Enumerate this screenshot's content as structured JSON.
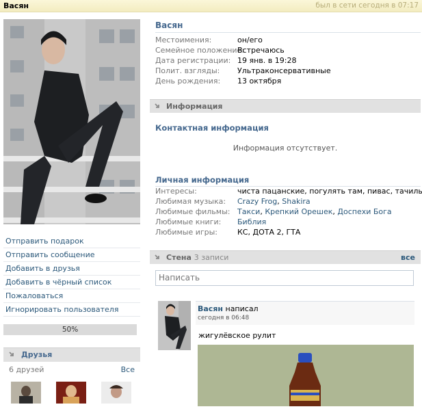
{
  "topbar": {
    "name": "Васян",
    "online": "был в сети сегодня в 07:17"
  },
  "left": {
    "actions": [
      "Отправить подарок",
      "Отправить сообщение",
      "Добавить в друзья",
      "Добавить в чёрный список",
      "Пожаловаться",
      "Игнорировать пользователя"
    ],
    "rating": "50%",
    "friends": {
      "title": "Друзья",
      "count": "6 друзей",
      "all": "Все"
    }
  },
  "profile": {
    "name": "Васян",
    "fields": [
      {
        "label": "Местоимения:",
        "value": "он/его"
      },
      {
        "label": "Семейное положение:",
        "value": "Встречаюсь"
      },
      {
        "label": "Дата регистрации:",
        "value": "19 янв. в 19:28"
      },
      {
        "label": "Полит. взгляды:",
        "value": "Ультраконсервативные"
      },
      {
        "label": "День рождения:",
        "value": "13 октября"
      }
    ]
  },
  "info": {
    "title": "Информация",
    "contact_title": "Контактная информация",
    "contact_empty": "Информация отсутствует.",
    "personal_title": "Личная информация",
    "personal": [
      {
        "label": "Интересы:",
        "value": "чиста пацанские, погулять там, пивас, тачилы",
        "links": []
      },
      {
        "label": "Любимая музыка:",
        "links": [
          "Crazy Frog",
          "Shakira"
        ]
      },
      {
        "label": "Любимые фильмы:",
        "links": [
          "Такси",
          "Крепкий Орешек",
          "Доспехи Бога"
        ]
      },
      {
        "label": "Любимые книги:",
        "links": [
          "Библия"
        ]
      },
      {
        "label": "Любимые игры:",
        "value": "КС, ДОТА 2, ГТА",
        "links": []
      }
    ]
  },
  "wall": {
    "title": "Стена",
    "count": "3 записи",
    "all": "все",
    "placeholder": "Написать",
    "post": {
      "author": "Васян",
      "action": "написал",
      "time": "сегодня в 06:48",
      "text": "жигулёвское рулит"
    }
  },
  "colors": {
    "link": "#2b587a",
    "heading": "#45688e",
    "topbar": "#f3ecc0"
  }
}
